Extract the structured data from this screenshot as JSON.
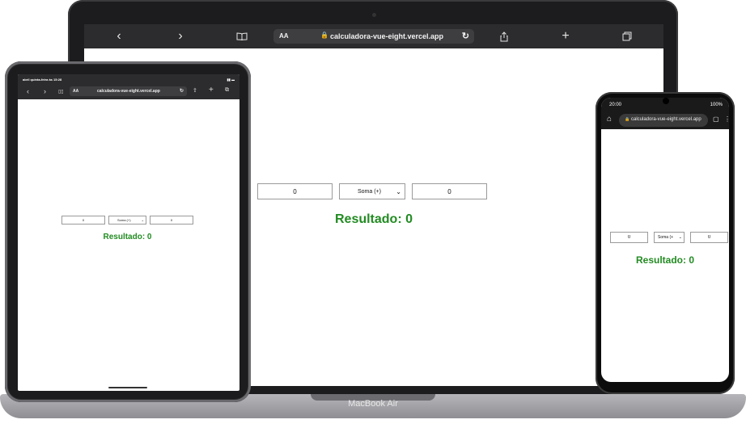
{
  "mac": {
    "url": "calculadora-vue-eight.vercel.app",
    "reader_label": "AA",
    "label": "MacBook Air",
    "calc": {
      "num1": "0",
      "operation": "Soma (+)",
      "num2": "0",
      "result": "Resultado: 0"
    }
  },
  "ipad": {
    "status_time": "abril quinta-feira às 15:28",
    "reader_label": "AA",
    "url": "calculadora-vue-eight.vercel.app",
    "calc": {
      "num1": "0",
      "operation": "Soma (+)",
      "num2": "0",
      "result": "Resultado: 0"
    }
  },
  "phone": {
    "status_time": "20:00",
    "battery": "100%",
    "url": "calculadora-vue-eight.vercel.app",
    "calc": {
      "num1": "0",
      "operation": "Soma (+",
      "num2": "0",
      "result": "Resultado: 0"
    }
  },
  "colors": {
    "result": "#228b22",
    "browser_chrome": "#2c2c2e"
  }
}
